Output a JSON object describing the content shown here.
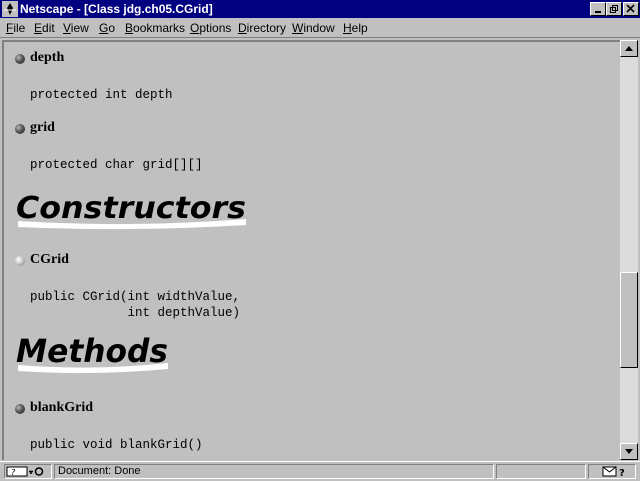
{
  "window": {
    "title": "Netscape - [Class jdg.ch05.CGrid]"
  },
  "menubar": {
    "items": [
      {
        "label": "File",
        "accel": "F",
        "rest": "ile"
      },
      {
        "label": "Edit",
        "accel": "E",
        "rest": "dit"
      },
      {
        "label": "View",
        "accel": "V",
        "rest": "iew"
      },
      {
        "label": "Go",
        "accel": "G",
        "rest": "o"
      },
      {
        "label": "Bookmarks",
        "accel": "B",
        "rest": "ookmarks"
      },
      {
        "label": "Options",
        "accel": "O",
        "rest": "ptions"
      },
      {
        "label": "Directory",
        "accel": "D",
        "rest": "irectory"
      },
      {
        "label": "Window",
        "accel": "W",
        "rest": "indow"
      },
      {
        "label": "Help",
        "accel": "H",
        "rest": "elp"
      }
    ]
  },
  "content": {
    "variables": [
      {
        "name": "depth",
        "declaration": "protected int depth"
      },
      {
        "name": "grid",
        "declaration": "protected char grid[][]"
      }
    ],
    "constructors_heading": "Constructors",
    "constructors": [
      {
        "name": "CGrid",
        "declaration": "public CGrid(int widthValue,\n             int depthValue)"
      }
    ],
    "methods_heading": "Methods",
    "methods": [
      {
        "name": "blankGrid",
        "declaration": "public void blankGrid()"
      }
    ]
  },
  "statusbar": {
    "text": "Document: Done"
  },
  "colors": {
    "titlebar": "#000080",
    "chrome": "#c0c0c0",
    "page_background": "#c0c0c0",
    "text": "#000000"
  },
  "icons": [
    "netscape-app-icon",
    "minimize-icon",
    "maximize-icon",
    "close-icon",
    "scroll-up-icon",
    "scroll-down-icon",
    "security-key-icon",
    "mail-icon",
    "question-icon"
  ]
}
